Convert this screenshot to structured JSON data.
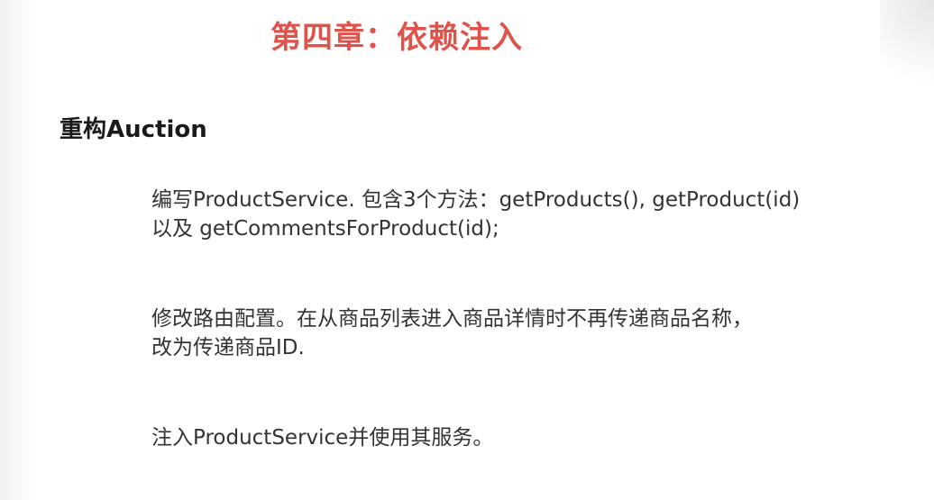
{
  "slide": {
    "title": "第四章：依赖注入",
    "heading": "重构Auction",
    "items": [
      {
        "lines": [
          "编写ProductService. 包含3个方法：getProducts(), getProduct(id)",
          "以及 getCommentsForProduct(id);"
        ]
      },
      {
        "lines": [
          "修改路由配置。在从商品列表进入商品详情时不再传递商品名称，",
          "改为传递商品ID."
        ]
      },
      {
        "lines": [
          "注入ProductService并使用其服务。"
        ]
      }
    ]
  },
  "colors": {
    "title": "#e0534a",
    "heading": "#1a1a1a",
    "body_text": "#333333",
    "background": "#ffffff"
  }
}
